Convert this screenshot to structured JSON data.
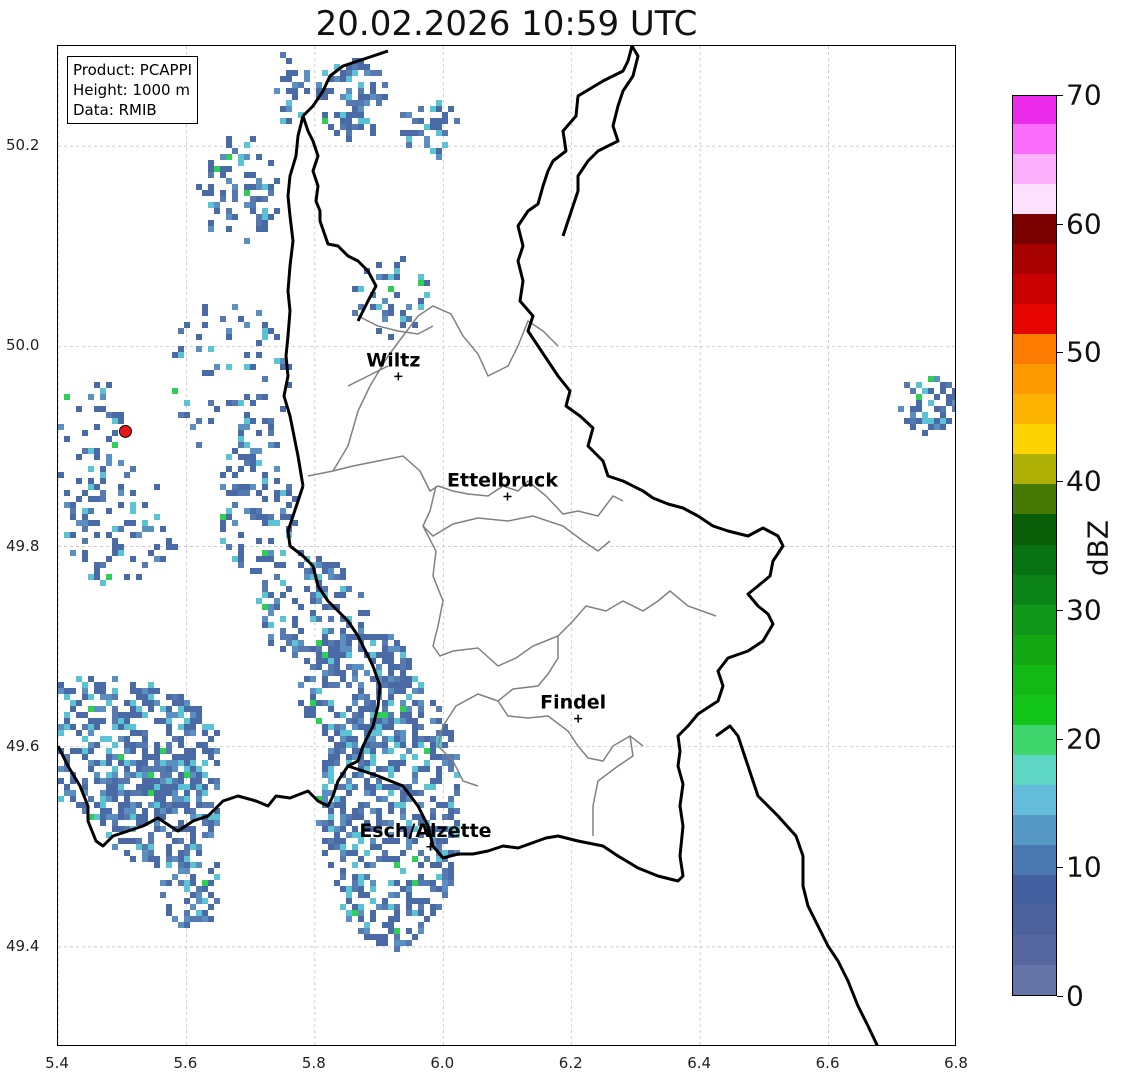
{
  "title": "20.02.2026 10:59 UTC",
  "info_box": {
    "product": "Product: PCAPPI",
    "height": "Height: 1000 m",
    "data": "Data: RMIB"
  },
  "axes": {
    "xlim": [
      5.4,
      6.8
    ],
    "ylim": [
      49.3,
      50.3
    ],
    "x_ticks": [
      "5.4",
      "5.6",
      "5.8",
      "6.0",
      "6.2",
      "6.4",
      "6.6",
      "6.8"
    ],
    "y_ticks": [
      "49.4",
      "49.6",
      "49.8",
      "50.0",
      "50.2"
    ],
    "grid": true
  },
  "cities": [
    {
      "name": "Wiltz",
      "lon": 5.93,
      "lat": 49.97
    },
    {
      "name": "Ettelbruck",
      "lon": 6.1,
      "lat": 49.85
    },
    {
      "name": "Findel",
      "lon": 6.21,
      "lat": 49.628
    },
    {
      "name": "Esch/Alzette",
      "lon": 5.98,
      "lat": 49.5
    }
  ],
  "radar_site": {
    "lon": 5.505,
    "lat": 49.915,
    "color": "#e8161b"
  },
  "colorbar": {
    "label": "dBZ",
    "range": [
      0,
      70
    ],
    "ticks": [
      "0",
      "10",
      "20",
      "30",
      "40",
      "50",
      "60",
      "70"
    ],
    "colors": [
      "#6474a6",
      "#56679f",
      "#4d629d",
      "#4360a1",
      "#4a79b2",
      "#5799c6",
      "#63bcd9",
      "#5ed6c4",
      "#3ed66d",
      "#12c518",
      "#12b813",
      "#13a813",
      "#11981a",
      "#0c8317",
      "#077211",
      "#085e07",
      "#467a05",
      "#afb106",
      "#fdd300",
      "#fdb302",
      "#fd9a02",
      "#fd7b00",
      "#e60400",
      "#c70000",
      "#a70100",
      "#7b0000",
      "#fde0fe",
      "#fcb0fc",
      "#fc6cfb",
      "#ec2bea"
    ]
  },
  "legend_colors": {
    "border": "#000000",
    "district": "#808080",
    "echo_low": "#4a6aa5",
    "echo_mid": "#5bc3d4",
    "echo_high": "#2fcf57"
  }
}
